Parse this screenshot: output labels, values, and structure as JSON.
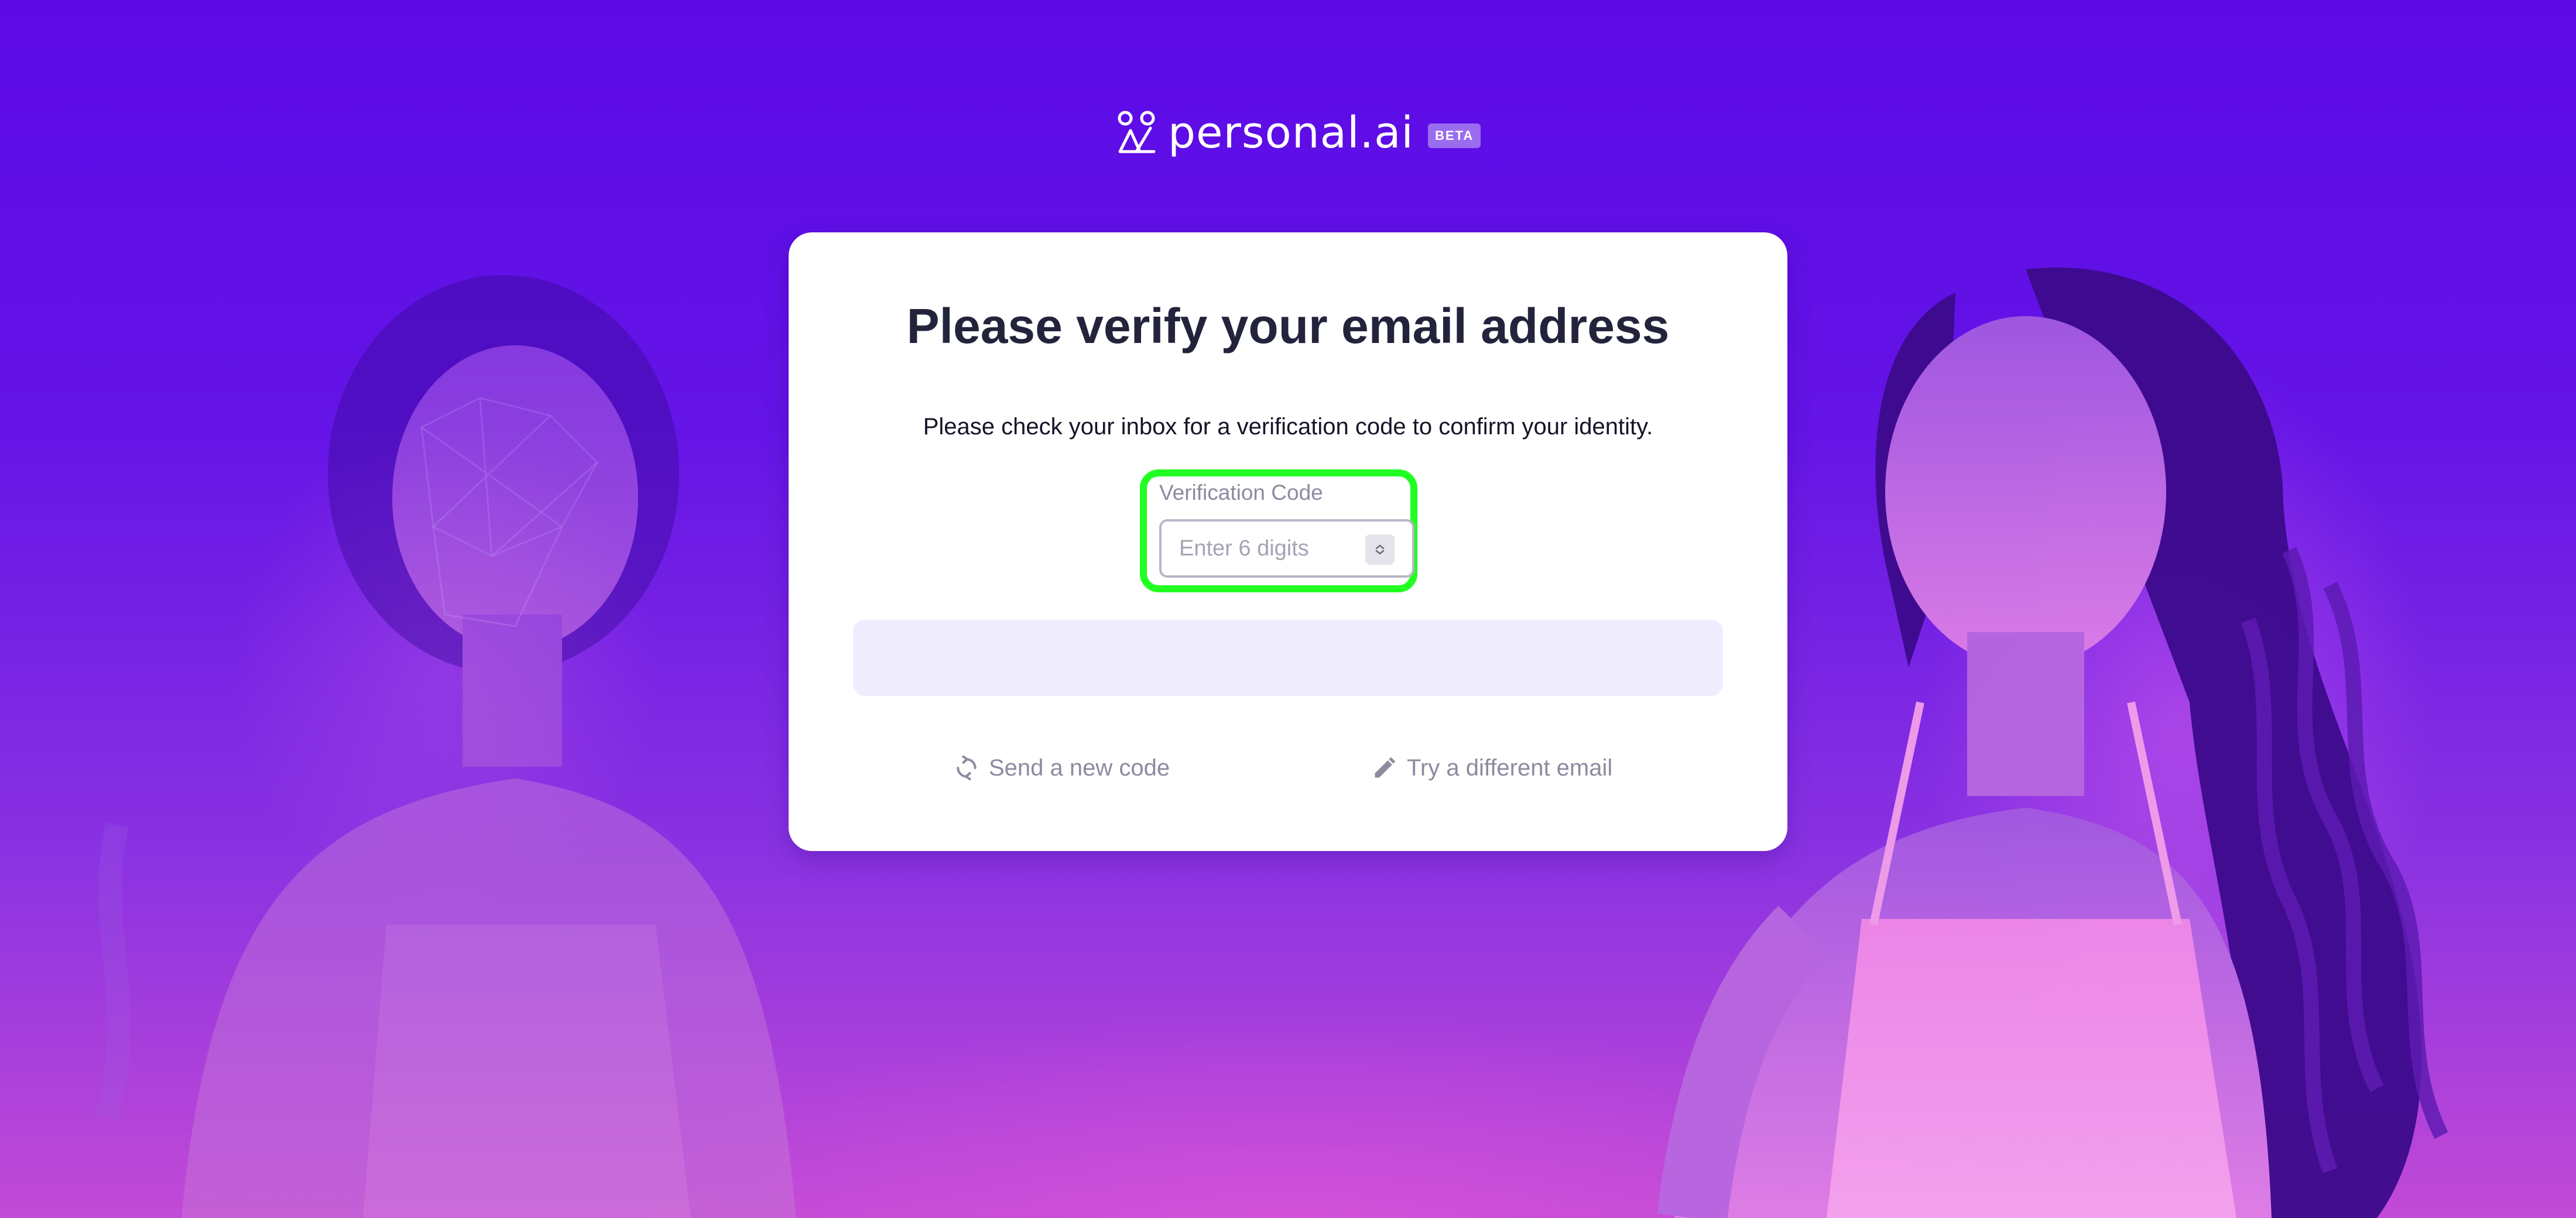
{
  "brand": {
    "name": "personal.ai",
    "badge": "BETA"
  },
  "verify_card": {
    "title": "Please verify your email address",
    "description": "Please check your inbox for a verification code to confirm your identity.",
    "code_field": {
      "label": "Verification Code",
      "placeholder": "Enter 6 digits",
      "value": ""
    },
    "submit_label": "",
    "resend_link": {
      "label": "Send a new code",
      "icon": "refresh-icon"
    },
    "change_email_link": {
      "label": "Try a different email",
      "icon": "pencil-icon"
    }
  },
  "colors": {
    "background_top": "#5b0ae6",
    "background_bottom": "#c24ad6",
    "highlight": "#22ff22",
    "submit_disabled": "#efecfd",
    "title_text": "#23243c",
    "muted_text": "#8b8ba0"
  }
}
